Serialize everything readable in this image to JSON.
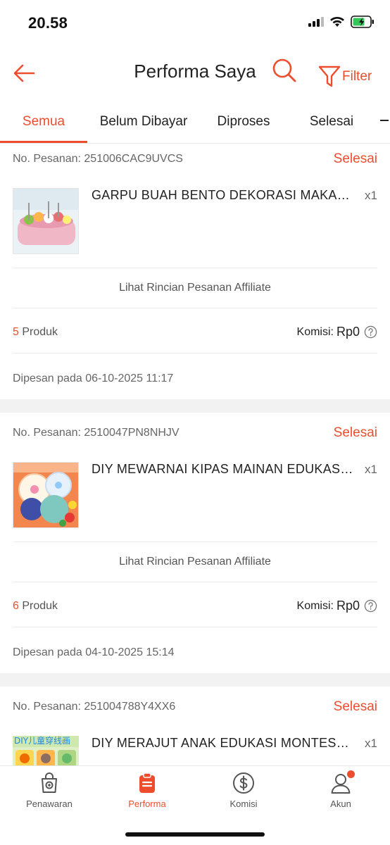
{
  "status_bar": {
    "time": "20.58"
  },
  "nav": {
    "title": "Performa Saya",
    "filter_label": "Filter"
  },
  "tabs": [
    {
      "label": "Semua",
      "active": true
    },
    {
      "label": "Belum Dibayar",
      "active": false
    },
    {
      "label": "Diproses",
      "active": false
    },
    {
      "label": "Selesai",
      "active": false
    }
  ],
  "orders": [
    {
      "order_no": "No. Pesanan: 251006CAC9UVCS",
      "status": "Selesai",
      "product_name": "GARPU BUAH BENTO DEKORASI MAKANAN",
      "qty": "x1",
      "detail_link": "Lihat Rincian Pesanan Affiliate",
      "product_count": "5",
      "product_count_suffix": " Produk",
      "commission_label": "Komisi:",
      "commission_value": "Rp0",
      "ordered_at": "Dipesan pada 06-10-2025 11:17"
    },
    {
      "order_no": "No. Pesanan: 2510047PN8NHJV",
      "status": "Selesai",
      "product_name": "DIY MEWARNAI KIPAS MAINAN EDUKASI ANAK",
      "qty": "x1",
      "detail_link": "Lihat Rincian Pesanan Affiliate",
      "product_count": "6",
      "product_count_suffix": " Produk",
      "commission_label": "Komisi:",
      "commission_value": "Rp0",
      "ordered_at": "Dipesan pada 04-10-2025 15:14"
    },
    {
      "order_no": "No. Pesanan: 251004788Y4XX6",
      "status": "Selesai",
      "product_name": "DIY MERAJUT ANAK EDUKASI MONTESSORI",
      "qty": "x1",
      "thumb_text": "DIY儿童穿线画"
    }
  ],
  "bottom_nav": [
    {
      "label": "Penawaran",
      "icon": "shopping-bag-icon"
    },
    {
      "label": "Performa",
      "icon": "clipboard-icon",
      "active": true
    },
    {
      "label": "Komisi",
      "icon": "dollar-circle-icon"
    },
    {
      "label": "Akun",
      "icon": "user-icon",
      "badge": true
    }
  ],
  "colors": {
    "accent": "#ee4d2d",
    "text": "#222222",
    "muted": "#666666",
    "divider": "#f2f2f2"
  }
}
